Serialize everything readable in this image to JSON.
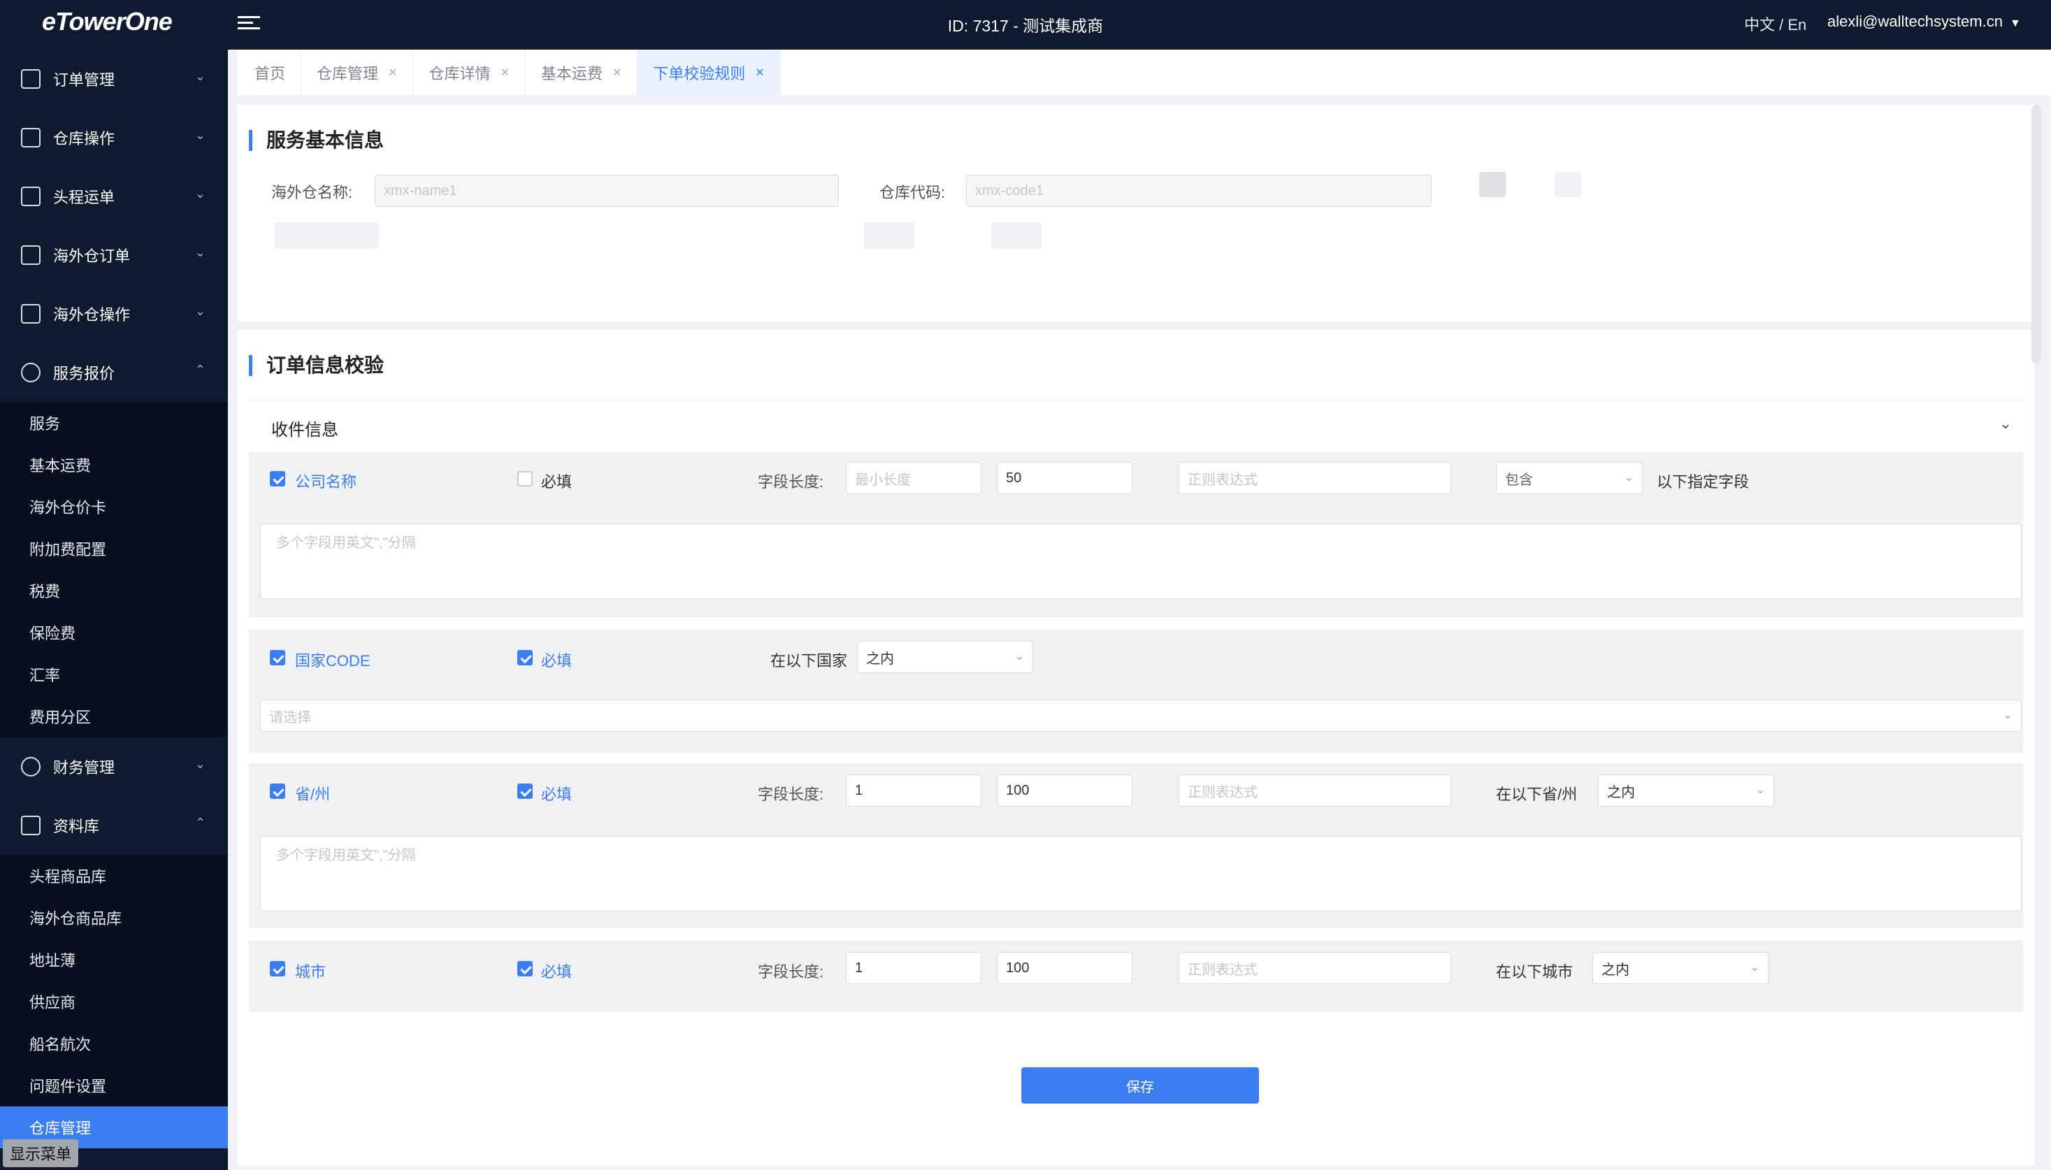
{
  "topbar": {
    "logo": "eTowerOne",
    "center_title": "ID: 7317 - 测试集成商",
    "language": "中文 / En",
    "user_email": "alexli@walltechsystem.cn"
  },
  "sidebar": {
    "groups": [
      {
        "label": "订单管理",
        "icon": "order-icon"
      },
      {
        "label": "仓库操作",
        "icon": "warehouse-ops-icon"
      },
      {
        "label": "头程运单",
        "icon": "firstleg-icon"
      },
      {
        "label": "海外仓订单",
        "icon": "overseas-order-icon"
      },
      {
        "label": "海外仓操作",
        "icon": "overseas-ops-icon"
      },
      {
        "label": "服务报价",
        "icon": "quote-icon"
      },
      {
        "label": "财务管理",
        "icon": "finance-icon"
      },
      {
        "label": "资料库",
        "icon": "library-icon"
      }
    ],
    "quote_items": [
      "服务",
      "基本运费",
      "海外仓价卡",
      "附加费配置",
      "税费",
      "保险费",
      "汇率",
      "费用分区"
    ],
    "library_items": [
      "头程商品库",
      "海外仓商品库",
      "地址薄",
      "供应商",
      "船名航次",
      "问题件设置",
      "仓库管理"
    ],
    "show_menu": "显示菜单"
  },
  "tabs": [
    {
      "label": "首页",
      "closable": false
    },
    {
      "label": "仓库管理",
      "closable": true
    },
    {
      "label": "仓库详情",
      "closable": true
    },
    {
      "label": "基本运费",
      "closable": true
    },
    {
      "label": "下单校验规则",
      "closable": true,
      "active": true
    }
  ],
  "basic_info": {
    "title": "服务基本信息",
    "warehouse_name_label": "海外仓名称:",
    "warehouse_name_placeholder": "xmx-name1",
    "warehouse_code_label": "仓库代码:",
    "warehouse_code_placeholder": "xmx-code1"
  },
  "order_check": {
    "title": "订单信息校验",
    "section": "收件信息",
    "rows": {
      "company": {
        "name": "公司名称",
        "required_label": "必填",
        "length_label": "字段长度:",
        "min_placeholder": "最小长度",
        "max_value": "50",
        "regex_placeholder": "正则表达式",
        "select_value": "包含",
        "suffix": "以下指定字段",
        "textarea_placeholder": "多个字段用英文\",\"分隔"
      },
      "country": {
        "name": "国家CODE",
        "required_label": "必填",
        "in_label": "在以下国家",
        "select_value": "之内",
        "multi_placeholder": "请选择"
      },
      "province": {
        "name": "省/州",
        "required_label": "必填",
        "length_label": "字段长度:",
        "min_value": "1",
        "max_value": "100",
        "regex_placeholder": "正则表达式",
        "in_label": "在以下省/州",
        "select_value": "之内",
        "textarea_placeholder": "多个字段用英文\",\"分隔"
      },
      "city": {
        "name": "城市",
        "required_label": "必填",
        "length_label": "字段长度:",
        "min_value": "1",
        "max_value": "100",
        "regex_placeholder": "正则表达式",
        "in_label": "在以下城市",
        "select_value": "之内"
      }
    },
    "save_label": "保存"
  },
  "colors": {
    "accent": "#3d7df2",
    "sidebar": "#0e1a2e"
  }
}
